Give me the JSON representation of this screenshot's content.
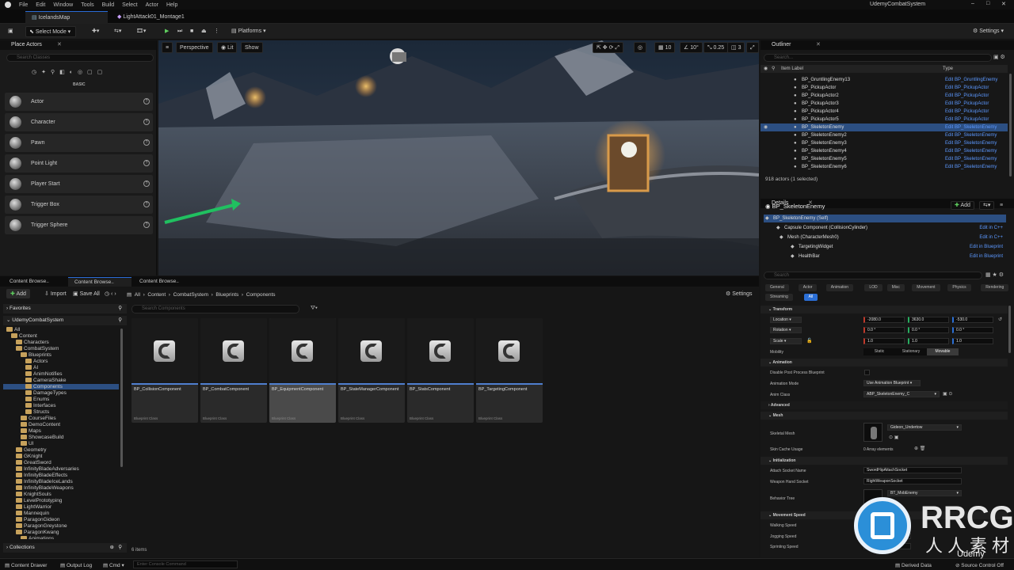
{
  "menu": [
    "File",
    "Edit",
    "Window",
    "Tools",
    "Build",
    "Select",
    "Actor",
    "Help"
  ],
  "tabs": {
    "level": "IcelandsMap",
    "montage": "LightAttack01_Montage1"
  },
  "project": "UdemyCombatSystem",
  "toolbar": {
    "mode": "Select Mode",
    "platforms": "Platforms",
    "settings": "Settings"
  },
  "place": {
    "title": "Place Actors",
    "search": "Search Classes",
    "category": "BASIC",
    "items": [
      "Actor",
      "Character",
      "Pawn",
      "Point Light",
      "Player Start",
      "Trigger Box",
      "Trigger Sphere"
    ]
  },
  "viewport": {
    "perspective": "Perspective",
    "lit": "Lit",
    "show": "Show",
    "grid": "10",
    "angle": "10°",
    "scale": "0.25",
    "cam": "3"
  },
  "content": {
    "tabs": [
      "Content Browse..",
      "Content Browse..",
      "Content Browse.."
    ],
    "add": "Add",
    "import": "Import",
    "save_all": "Save All",
    "path": [
      "All",
      "Content",
      "CombatSystem",
      "Blueprints",
      "Components"
    ],
    "settings": "Settings",
    "favorites": "Favorites",
    "root": "UdemyCombatSystem",
    "search": "Search Components",
    "count": "6 items",
    "collections": "Collections",
    "tree": [
      {
        "t": "All",
        "d": 0
      },
      {
        "t": "Content",
        "d": 1
      },
      {
        "t": "Characters",
        "d": 2
      },
      {
        "t": "CombatSystem",
        "d": 2
      },
      {
        "t": "Blueprints",
        "d": 3
      },
      {
        "t": "Actors",
        "d": 4
      },
      {
        "t": "AI",
        "d": 4
      },
      {
        "t": "AnimNotifies",
        "d": 4
      },
      {
        "t": "CameraShake",
        "d": 4
      },
      {
        "t": "Components",
        "d": 4
      },
      {
        "t": "DamageTypes",
        "d": 4
      },
      {
        "t": "Enums",
        "d": 4
      },
      {
        "t": "Interfaces",
        "d": 4
      },
      {
        "t": "Structs",
        "d": 4
      },
      {
        "t": "CourseFiles",
        "d": 3
      },
      {
        "t": "DemoContent",
        "d": 3
      },
      {
        "t": "Maps",
        "d": 3
      },
      {
        "t": "ShowcaseBuild",
        "d": 3
      },
      {
        "t": "UI",
        "d": 3
      },
      {
        "t": "Geometry",
        "d": 2
      },
      {
        "t": "GKnight",
        "d": 2
      },
      {
        "t": "GreatSword",
        "d": 2
      },
      {
        "t": "InfinityBladeAdversaries",
        "d": 2
      },
      {
        "t": "InfinityBladeEffects",
        "d": 2
      },
      {
        "t": "InfinityBladeIceLands",
        "d": 2
      },
      {
        "t": "InfinityBladeWeapons",
        "d": 2
      },
      {
        "t": "KnightSouls",
        "d": 2
      },
      {
        "t": "LevelPrototyping",
        "d": 2
      },
      {
        "t": "LightWarrior",
        "d": 2
      },
      {
        "t": "Mannequin",
        "d": 2
      },
      {
        "t": "ParagonGideon",
        "d": 2
      },
      {
        "t": "ParagonGreystone",
        "d": 2
      },
      {
        "t": "ParagonKwang",
        "d": 2
      },
      {
        "t": "Animations",
        "d": 3
      }
    ],
    "assets": [
      {
        "name": "BP_CollisionComponent",
        "cls": "Blueprint Class"
      },
      {
        "name": "BP_CombatComponent",
        "cls": "Blueprint Class"
      },
      {
        "name": "BP_EquipmentComponent",
        "cls": "Blueprint Class"
      },
      {
        "name": "BP_StateManagerComponent",
        "cls": "Blueprint Class"
      },
      {
        "name": "BP_StatsComponent",
        "cls": "Blueprint Class"
      },
      {
        "name": "BP_TargetingComponent",
        "cls": "Blueprint Class"
      }
    ]
  },
  "outliner": {
    "title": "Outliner",
    "search": "Search...",
    "col_label": "Item Label",
    "col_type": "Type",
    "rows": [
      {
        "n": "BP_GruntlingEnemy13",
        "t": "Edit BP_GruntlingEnemy"
      },
      {
        "n": "BP_PickupActor",
        "t": "Edit BP_PickupActor"
      },
      {
        "n": "BP_PickupActor2",
        "t": "Edit BP_PickupActor"
      },
      {
        "n": "BP_PickupActor3",
        "t": "Edit BP_PickupActor"
      },
      {
        "n": "BP_PickupActor4",
        "t": "Edit BP_PickupActor"
      },
      {
        "n": "BP_PickupActor5",
        "t": "Edit BP_PickupActor"
      },
      {
        "n": "BP_SkeletonEnemy",
        "t": "Edit BP_SkeletonEnemy"
      },
      {
        "n": "BP_SkeletonEnemy2",
        "t": "Edit BP_SkeletonEnemy"
      },
      {
        "n": "BP_SkeletonEnemy3",
        "t": "Edit BP_SkeletonEnemy"
      },
      {
        "n": "BP_SkeletonEnemy4",
        "t": "Edit BP_SkeletonEnemy"
      },
      {
        "n": "BP_SkeletonEnemy5",
        "t": "Edit BP_SkeletonEnemy"
      },
      {
        "n": "BP_SkeletonEnemy6",
        "t": "Edit BP_SkeletonEnemy"
      }
    ],
    "count": "918 actors (1 selected)"
  },
  "details": {
    "title": "Details",
    "actor": "BP_SkeletonEnemy",
    "add": "Add",
    "components": [
      {
        "n": "BP_SkeletonEnemy (Self)",
        "l": ""
      },
      {
        "n": "Capsule Component (CollisionCylinder)",
        "l": "Edit in C++"
      },
      {
        "n": "Mesh (CharacterMesh0)",
        "l": "Edit in C++"
      },
      {
        "n": "TargetingWidget",
        "l": "Edit in Blueprint"
      },
      {
        "n": "HealthBar",
        "l": "Edit in Blueprint"
      }
    ],
    "search": "Search",
    "filters": [
      "General",
      "Actor",
      "Animation",
      "LOD",
      "Misc",
      "Movement",
      "Physics",
      "Rendering",
      "Streaming",
      "All"
    ],
    "transform": {
      "title": "Transform",
      "location": "Location",
      "rotation": "Rotation",
      "scale": "Scale",
      "loc": [
        "-2080.0",
        "3630.0",
        "-530.0"
      ],
      "rot": [
        "0.0 °",
        "0.0 °",
        "0.0 °"
      ],
      "scl": [
        "1.0",
        "1.0",
        "1.0"
      ],
      "mobility": "Mobility",
      "mob": [
        "Static",
        "Stationary",
        "Movable"
      ]
    },
    "animation": {
      "title": "Animation",
      "disable_pp": "Disable Post Process Blueprint",
      "mode_l": "Animation Mode",
      "mode": "Use Animation Blueprint",
      "class_l": "Anim Class",
      "class": "ABP_SkeletonEnemy_C"
    },
    "advanced": "Advanced",
    "mesh": {
      "title": "Mesh",
      "sk_l": "Skeletal Mesh",
      "sk": "Gideon_Undertow",
      "cache_l": "Skin Cache Usage",
      "cache": "0 Array elements"
    },
    "init": {
      "title": "Initialization",
      "attach_l": "Attach Socket Name",
      "attach": "SwordHipAttachSocket",
      "weapon_l": "Weapon Hand Socket",
      "weapon": "RightWeaponSocket",
      "bt_l": "Behavior Tree",
      "bt": "BT_MobEnemy"
    },
    "move": {
      "title": "Movement Speed",
      "walk": "Walking Speed",
      "jog": "Jogging Speed",
      "sprint": "Sprinting Speed"
    }
  },
  "status": {
    "drawer": "Content Drawer",
    "log": "Output Log",
    "cmd": "Cmd",
    "console": "Enter Console Command",
    "derived": "Derived Data",
    "source": "Source Control Off"
  },
  "watermark": {
    "brand": "RRCG",
    "sub": "人人素材",
    "udemy": "Udemy"
  }
}
